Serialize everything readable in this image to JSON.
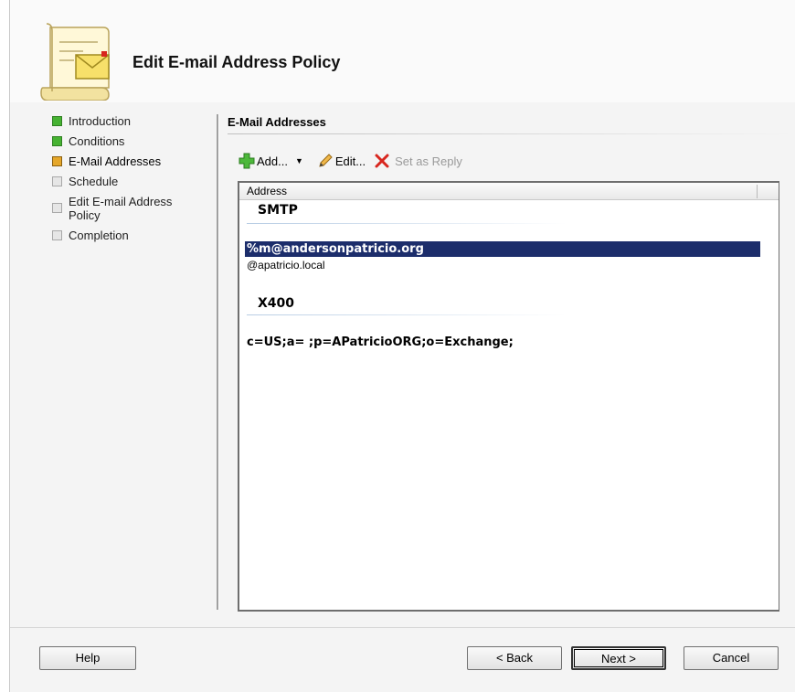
{
  "window": {
    "title": "Edit E-mail Address Policy"
  },
  "steps": [
    {
      "label": "Introduction",
      "state": "done"
    },
    {
      "label": "Conditions",
      "state": "done"
    },
    {
      "label": "E-Mail Addresses",
      "state": "current"
    },
    {
      "label": "Schedule",
      "state": "todo"
    },
    {
      "label": "Edit E-mail Address Policy",
      "state": "todo"
    },
    {
      "label": "Completion",
      "state": "todo"
    }
  ],
  "content": {
    "section_title": "E-Mail Addresses",
    "toolbar": {
      "add_label": "Add...",
      "edit_label": "Edit...",
      "set_reply_label": "Set as Reply"
    },
    "list": {
      "column_header": "Address",
      "groups": [
        {
          "name": "SMTP",
          "items": [
            "%m@andersonpatricio.org",
            "@apatricio.local"
          ],
          "selected_index": 0
        },
        {
          "name": "X400",
          "items": [
            "c=US;a= ;p=APatricioORG;o=Exchange;"
          ]
        }
      ]
    }
  },
  "buttons": {
    "help": "Help",
    "back": "< Back",
    "next": "Next >",
    "cancel": "Cancel"
  },
  "colors": {
    "selection": "#1c2d6b",
    "step_done": "#46b232",
    "step_current": "#e5a72a",
    "step_todo": "#e6e6e6"
  },
  "icons": {
    "wizard": "scroll-mail-icon",
    "add": "green-plus-icon",
    "edit": "pencil-icon",
    "set_reply": "red-x-icon"
  }
}
